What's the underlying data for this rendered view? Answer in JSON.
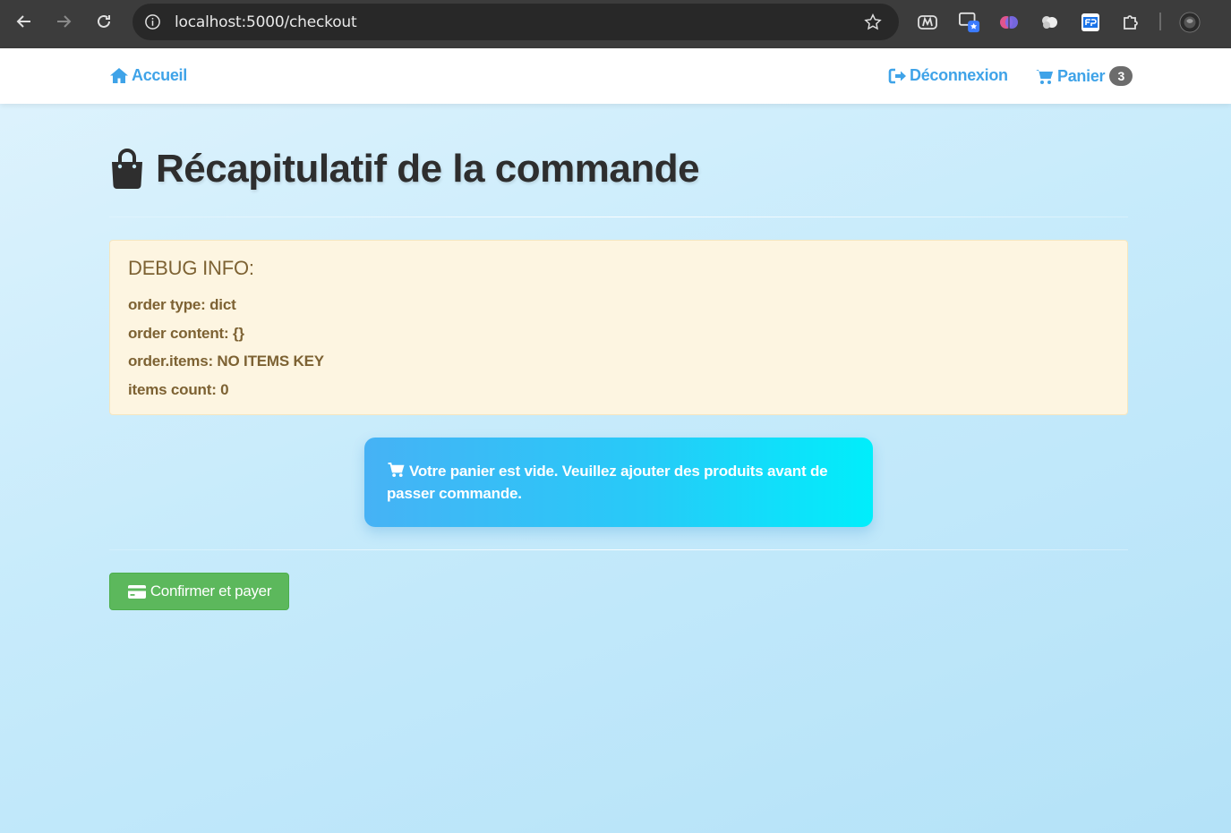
{
  "browser": {
    "url": "localhost:5000/checkout"
  },
  "navbar": {
    "home_label": "Accueil",
    "logout_label": "Déconnexion",
    "cart_label": "Panier",
    "cart_count": "3"
  },
  "page": {
    "title": "Récapitulatif de la commande",
    "debug": {
      "heading": "DEBUG INFO:",
      "lines": [
        "order type: dict",
        "order content: {}",
        "order.items: NO ITEMS KEY",
        "items count: 0"
      ]
    },
    "alert_text": "Votre panier est vide. Veuillez ajouter des produits avant de passer commande.",
    "confirm_button": "Confirmer et payer"
  },
  "colors": {
    "link": "#3fa3e8",
    "success": "#5cb85c",
    "warning_bg": "#fdf5e1",
    "warning_text": "#7d6233"
  }
}
